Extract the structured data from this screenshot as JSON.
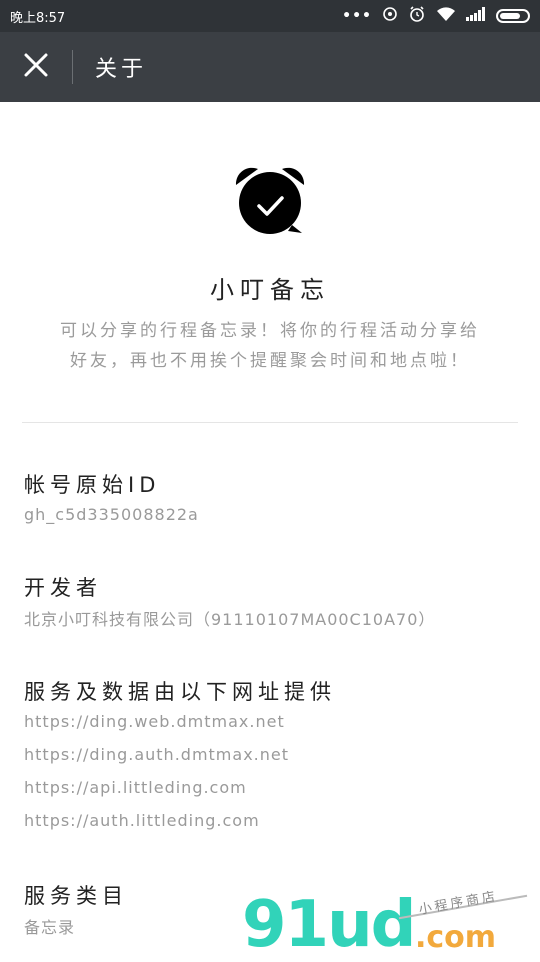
{
  "status_bar": {
    "time": "晚上8:57",
    "dots": "•••",
    "icons": [
      "sync-icon",
      "alarm-icon",
      "wifi-icon",
      "signal-icon",
      "battery-icon"
    ]
  },
  "nav": {
    "title": "关于",
    "close_icon": "close-icon"
  },
  "app": {
    "name": "小叮备忘",
    "description_line1": "可以分享的行程备忘录！将你的行程活动分享给",
    "description_line2": "好友，再也不用挨个提醒聚会时间和地点啦！",
    "logo_icon": "alarm-clock-check-icon"
  },
  "sections": {
    "account": {
      "title": "帐号原始ID",
      "value": "gh_c5d335008822a"
    },
    "developer": {
      "title": "开发者",
      "value": "北京小叮科技有限公司（91110107MA00C10A70）"
    },
    "domains": {
      "title": "服务及数据由以下网址提供",
      "urls": [
        "https://ding.web.dmtmax.net",
        "https://ding.auth.dmtmax.net",
        "https://api.littleding.com",
        "https://auth.littleding.com"
      ]
    },
    "category": {
      "title": "服务类目",
      "value": "备忘录"
    }
  },
  "watermark": {
    "big": "91ud",
    "com": ".com",
    "small": "小程序商店"
  },
  "colors": {
    "status_bar": "#2f3337",
    "nav_bar": "#3b3f44",
    "watermark_green": "#31d3b9",
    "watermark_orange": "#f2a93c"
  }
}
